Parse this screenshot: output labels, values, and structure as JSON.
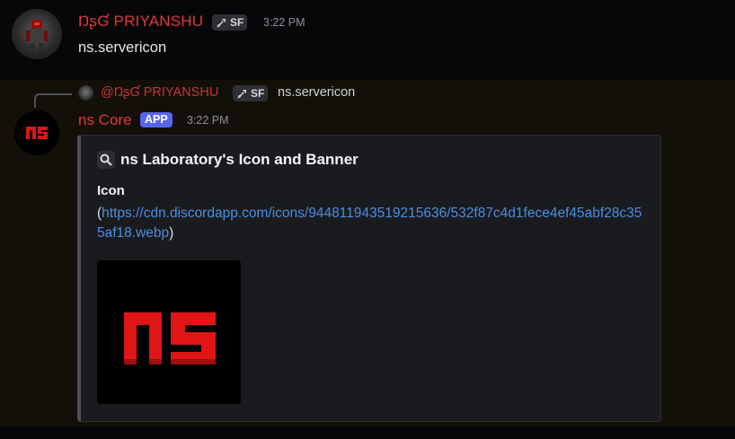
{
  "message1": {
    "author": "ŊʂƓ PRIYANSHU",
    "tag": "SF",
    "time": "3:22 PM",
    "content": "ns.servericon"
  },
  "message2": {
    "reply": {
      "author": "@ŊʂƓ PRIYANSHU",
      "tag": "SF",
      "content": "ns.servericon"
    },
    "author": "ns Core",
    "badge": "APP",
    "time": "3:22 PM",
    "embed": {
      "title": "ns Laboratory's Icon and Banner",
      "field_name": "Icon",
      "paren_open": "(",
      "link": "https://cdn.discordapp.com/icons/944811943519215636/532f87c4d1fece4ef45abf28c355af18.webp",
      "paren_close": ")"
    }
  },
  "colors": {
    "username": "#e03a3a",
    "link": "#4a8fe0",
    "app_badge": "#5865f2"
  },
  "icons": [
    "tag-sword-icon",
    "search-icon",
    "ns-logo-icon"
  ]
}
